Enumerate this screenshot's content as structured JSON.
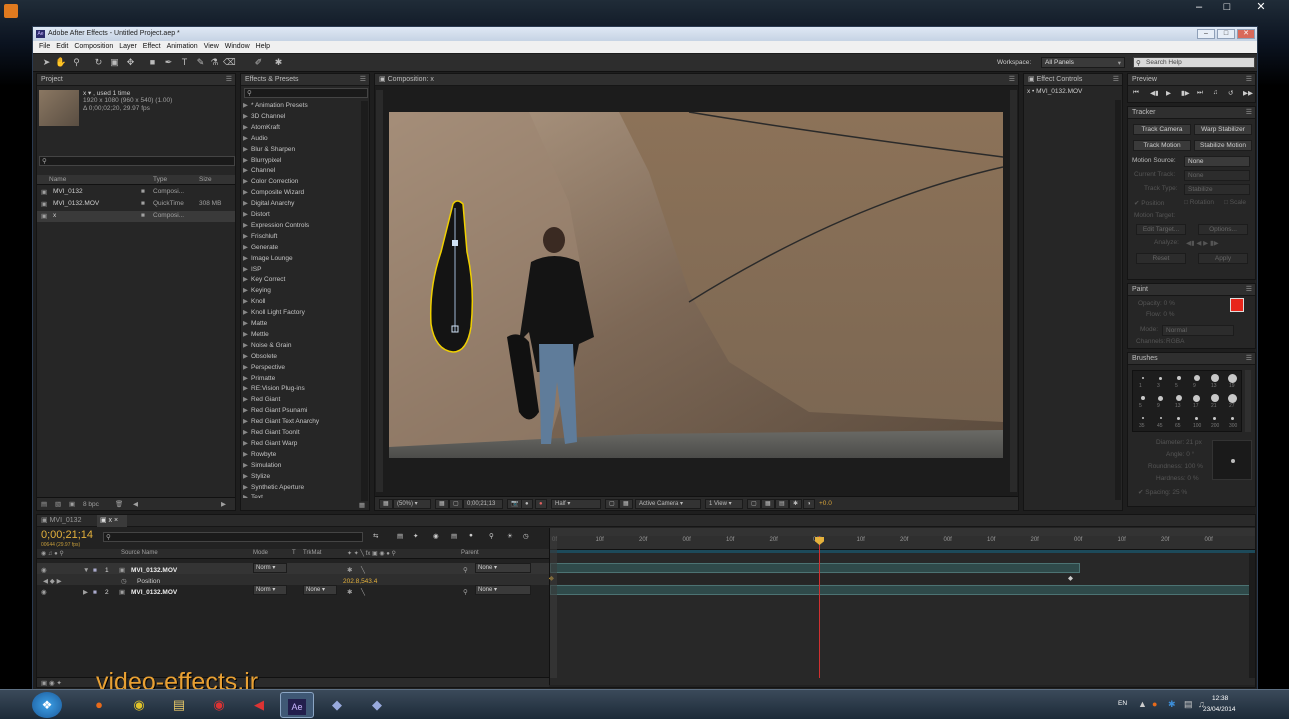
{
  "window": {
    "title": "Adobe After Effects - Untitled Project.aep *",
    "app_icon": "Ae"
  },
  "menu": [
    "File",
    "Edit",
    "Composition",
    "Layer",
    "Effect",
    "Animation",
    "View",
    "Window",
    "Help"
  ],
  "toolbar": {
    "workspace_label": "Workspace:",
    "workspace_value": "All Panels",
    "search_placeholder": "Search Help"
  },
  "project": {
    "tab": "Project",
    "preview_name": "x ▾ , used 1 time",
    "preview_res": "1920 x 1080  (960 x 540) (1.00)",
    "preview_dur": "Δ 0;00;02;20, 29.97 fps",
    "columns": [
      "Name",
      "Type",
      "Size"
    ],
    "items": [
      {
        "name": "MVI_0132",
        "type": "Composi...",
        "size": ""
      },
      {
        "name": "MVI_0132.MOV",
        "type": "QuickTime",
        "size": "308 MB"
      },
      {
        "name": "x",
        "type": "Composi...",
        "size": ""
      }
    ],
    "bpc": "8 bpc"
  },
  "effects": {
    "tab": "Effects & Presets",
    "items": [
      "* Animation Presets",
      "3D Channel",
      "AtomKraft",
      "Audio",
      "Blur & Sharpen",
      "Blurrypixel",
      "Channel",
      "Color Correction",
      "Composite Wizard",
      "Digital Anarchy",
      "Distort",
      "Expression Controls",
      "Frischluft",
      "Generate",
      "Image Lounge",
      "ISP",
      "Key Correct",
      "Keying",
      "Knoll",
      "Knoll Light Factory",
      "Matte",
      "Mettle",
      "Noise & Grain",
      "Obsolete",
      "Perspective",
      "Primatte",
      "RE:Vision Plug-ins",
      "Red Giant",
      "Red Giant Psunami",
      "Red Giant Text Anarchy",
      "Red Giant ToonIt",
      "Red Giant Warp",
      "Rowbyte",
      "Simulation",
      "Stylize",
      "Synthetic Aperture",
      "Text"
    ]
  },
  "composition": {
    "tab": "Composition: x",
    "footer": {
      "zoom": "(50%)",
      "timecode": "0;00;21;13",
      "resolution": "Half",
      "camera": "Active Camera",
      "views": "1 View",
      "exposure": "+0.0"
    }
  },
  "effect_controls": {
    "tab": "Effect Controls",
    "layer": "x • MVI_0132.MOV"
  },
  "preview": {
    "tab": "Preview"
  },
  "tracker": {
    "tab": "Tracker",
    "buttons": [
      "Track Camera",
      "Warp Stabilizer",
      "Track Motion",
      "Stabilize Motion"
    ],
    "motion_source_label": "Motion Source:",
    "motion_source_value": "None",
    "current_track_label": "Current Track:",
    "current_track_value": "None",
    "track_type_label": "Track Type:",
    "track_type_value": "Stabilize",
    "position": "Position",
    "rotation": "Rotation",
    "scale": "Scale",
    "motion_target": "Motion Target:",
    "edit_target": "Edit Target...",
    "options": "Options...",
    "analyze": "Analyze:",
    "reset": "Reset",
    "apply": "Apply"
  },
  "paint": {
    "tab": "Paint",
    "opacity": "Opacity: 0 %",
    "flow": "Flow: 0 %",
    "mode_label": "Mode:",
    "mode_value": "Normal",
    "channels_label": "Channels:",
    "channels_value": "RGBA",
    "fg_color": "#e8261b"
  },
  "brushes": {
    "tab": "Brushes",
    "diameter": "Diameter: 21 px",
    "angle": "Angle: 0 °",
    "roundness": "Roundness: 100 %",
    "hardness": "Hardness: 0 %",
    "spacing": "Spacing: 25 %",
    "sizes": [
      "1",
      "3",
      "5",
      "9",
      "13",
      "19",
      "5",
      "9",
      "13",
      "17",
      "21",
      "27",
      "35",
      "45",
      "65",
      "100",
      "200",
      "300"
    ]
  },
  "timeline": {
    "tabs": [
      "MVI_0132",
      "x"
    ],
    "timecode": "0;00;21;14",
    "frame_info": "00644 (29.97 fps)",
    "columns": [
      "Source Name",
      "Mode",
      "T",
      "TrkMat",
      "Parent"
    ],
    "layers": [
      {
        "num": "1",
        "name": "MVI_0132.MOV",
        "mode": "Norm",
        "trkmat": "",
        "parent": "None"
      },
      {
        "num": "2",
        "name": "MVI_0132.MOV",
        "mode": "Norm",
        "trkmat": "None",
        "parent": "None"
      }
    ],
    "position_prop": "Position",
    "position_value": "202.8,543.4",
    "ruler": [
      "0f",
      "10f",
      "20f",
      "00f",
      "10f",
      "20f",
      "00f",
      "10f",
      "20f",
      "00f",
      "10f",
      "20f",
      "00f",
      "10f",
      "20f",
      "00f"
    ]
  },
  "watermark": "video-effects.ir",
  "taskbar": {
    "lang": "EN",
    "time": "12:38",
    "date": "23/04/2014"
  }
}
